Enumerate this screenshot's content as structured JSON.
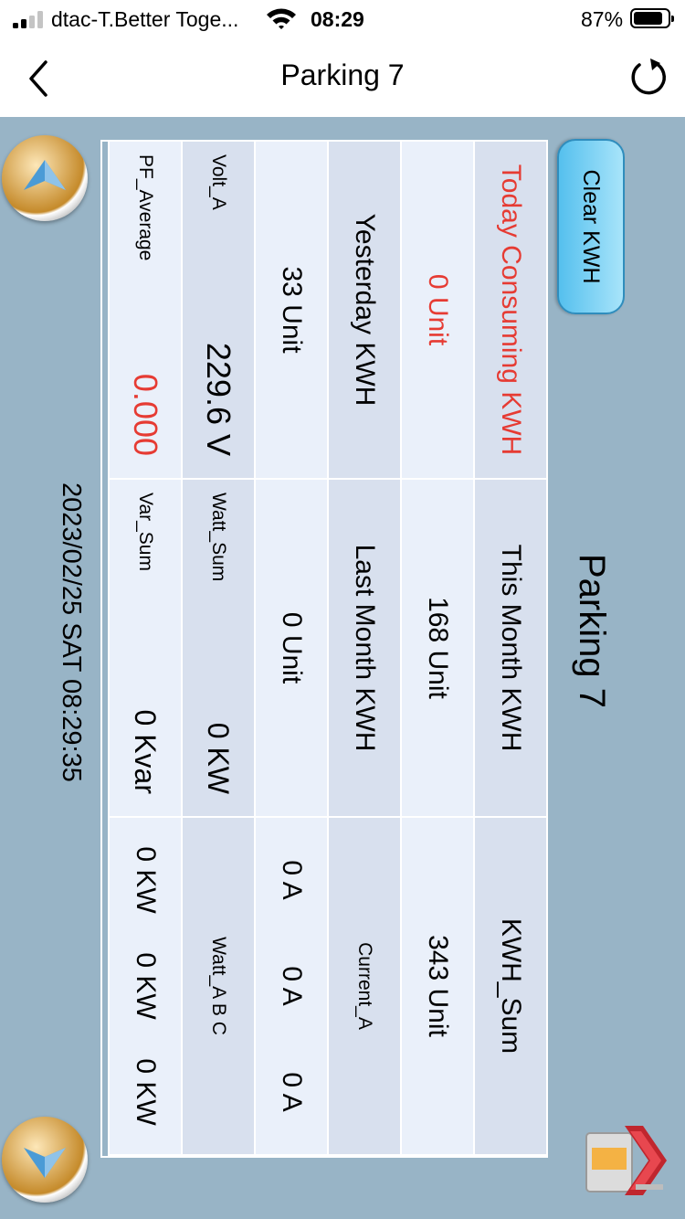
{
  "status_bar": {
    "carrier": "dtac-T.Better Toge...",
    "time": "08:29",
    "battery_percent": "87%",
    "signal_bars_filled": 2,
    "battery_level": 0.87
  },
  "nav": {
    "title": "Parking 7",
    "back_icon": "chevron-left-icon",
    "refresh_icon": "refresh-icon"
  },
  "panel": {
    "title": "Parking 7",
    "clear_button_label": "Clear KWH",
    "cells": {
      "today_label": "Today Consuming KWH",
      "today_value": "0 Unit",
      "yesterday_label": "Yesterday KWH",
      "yesterday_value": "33 Unit",
      "volt_label": "Volt_A",
      "volt_value": "229.6 V",
      "pf_label": "PF_Average",
      "pf_value": "0.000",
      "this_month_label": "This Month KWH",
      "this_month_value": "168 Unit",
      "last_month_label": "Last Month KWH",
      "last_month_value": "0 Unit",
      "watt_sum_label": "Watt_Sum",
      "watt_sum_value": "0 KW",
      "var_sum_label": "Var_Sum",
      "var_sum_value": "0 Kvar",
      "kwh_sum_label": "KWH_Sum",
      "kwh_sum_value": "343 Unit",
      "current_label": "Current_A",
      "current_values": [
        "0 A",
        "0 A",
        "0 A"
      ],
      "watt_abc_label": "Watt_A B C",
      "watt_abc_values": [
        "0 KW",
        "0 KW",
        "0 KW"
      ]
    },
    "datetime": "2023/02/25  SAT  08:29:35"
  },
  "colors": {
    "background": "#98b4c6",
    "label_cell": "#d8e0ee",
    "value_cell": "#eaf0fa",
    "highlight_red": "#e63b33",
    "button_blue": "#55c0ee"
  }
}
